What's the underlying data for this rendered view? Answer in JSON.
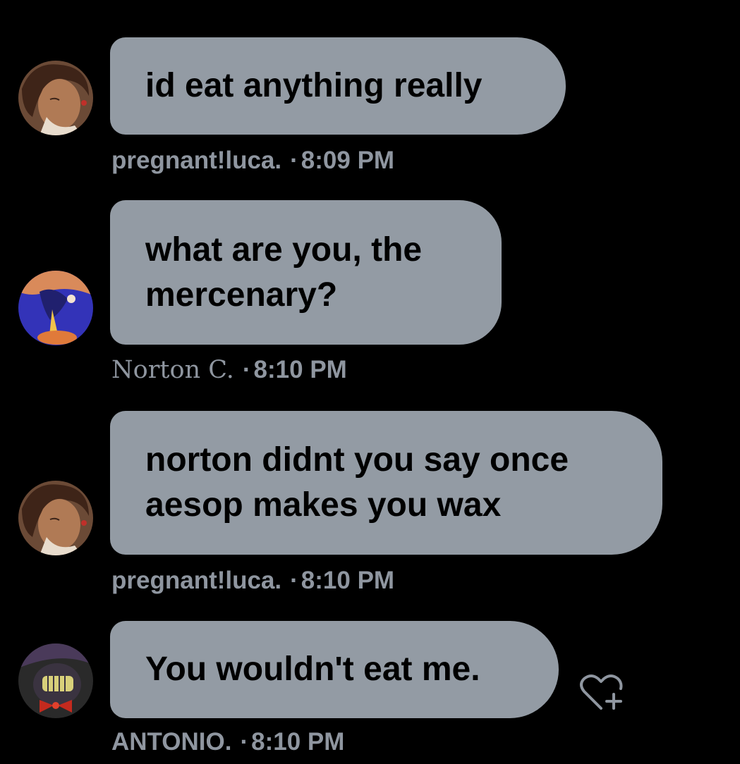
{
  "messages": [
    {
      "lines": [
        "id eat anything really"
      ],
      "sender": "pregnant!luca.",
      "time": "8:09 PM",
      "avatar": "luca-avatar"
    },
    {
      "lines": [
        "what are you, the",
        "mercenary?"
      ],
      "sender": "Norton C.",
      "time": "8:10 PM",
      "avatar": "norton-avatar"
    },
    {
      "lines": [
        "norton didnt you say once",
        "aesop makes you wax"
      ],
      "sender": "pregnant!luca.",
      "time": "8:10 PM",
      "avatar": "luca-avatar"
    },
    {
      "lines": [
        "You wouldn't eat me."
      ],
      "sender": "ANTONIO.",
      "time": "8:10 PM",
      "avatar": "antonio-avatar"
    }
  ],
  "separator": "·",
  "icons": {
    "reaction": "heart-plus-icon"
  },
  "colors": {
    "background": "#000000",
    "bubble": "#939ba4",
    "bubble_text": "#000000",
    "meta_text": "#8f96a0"
  }
}
